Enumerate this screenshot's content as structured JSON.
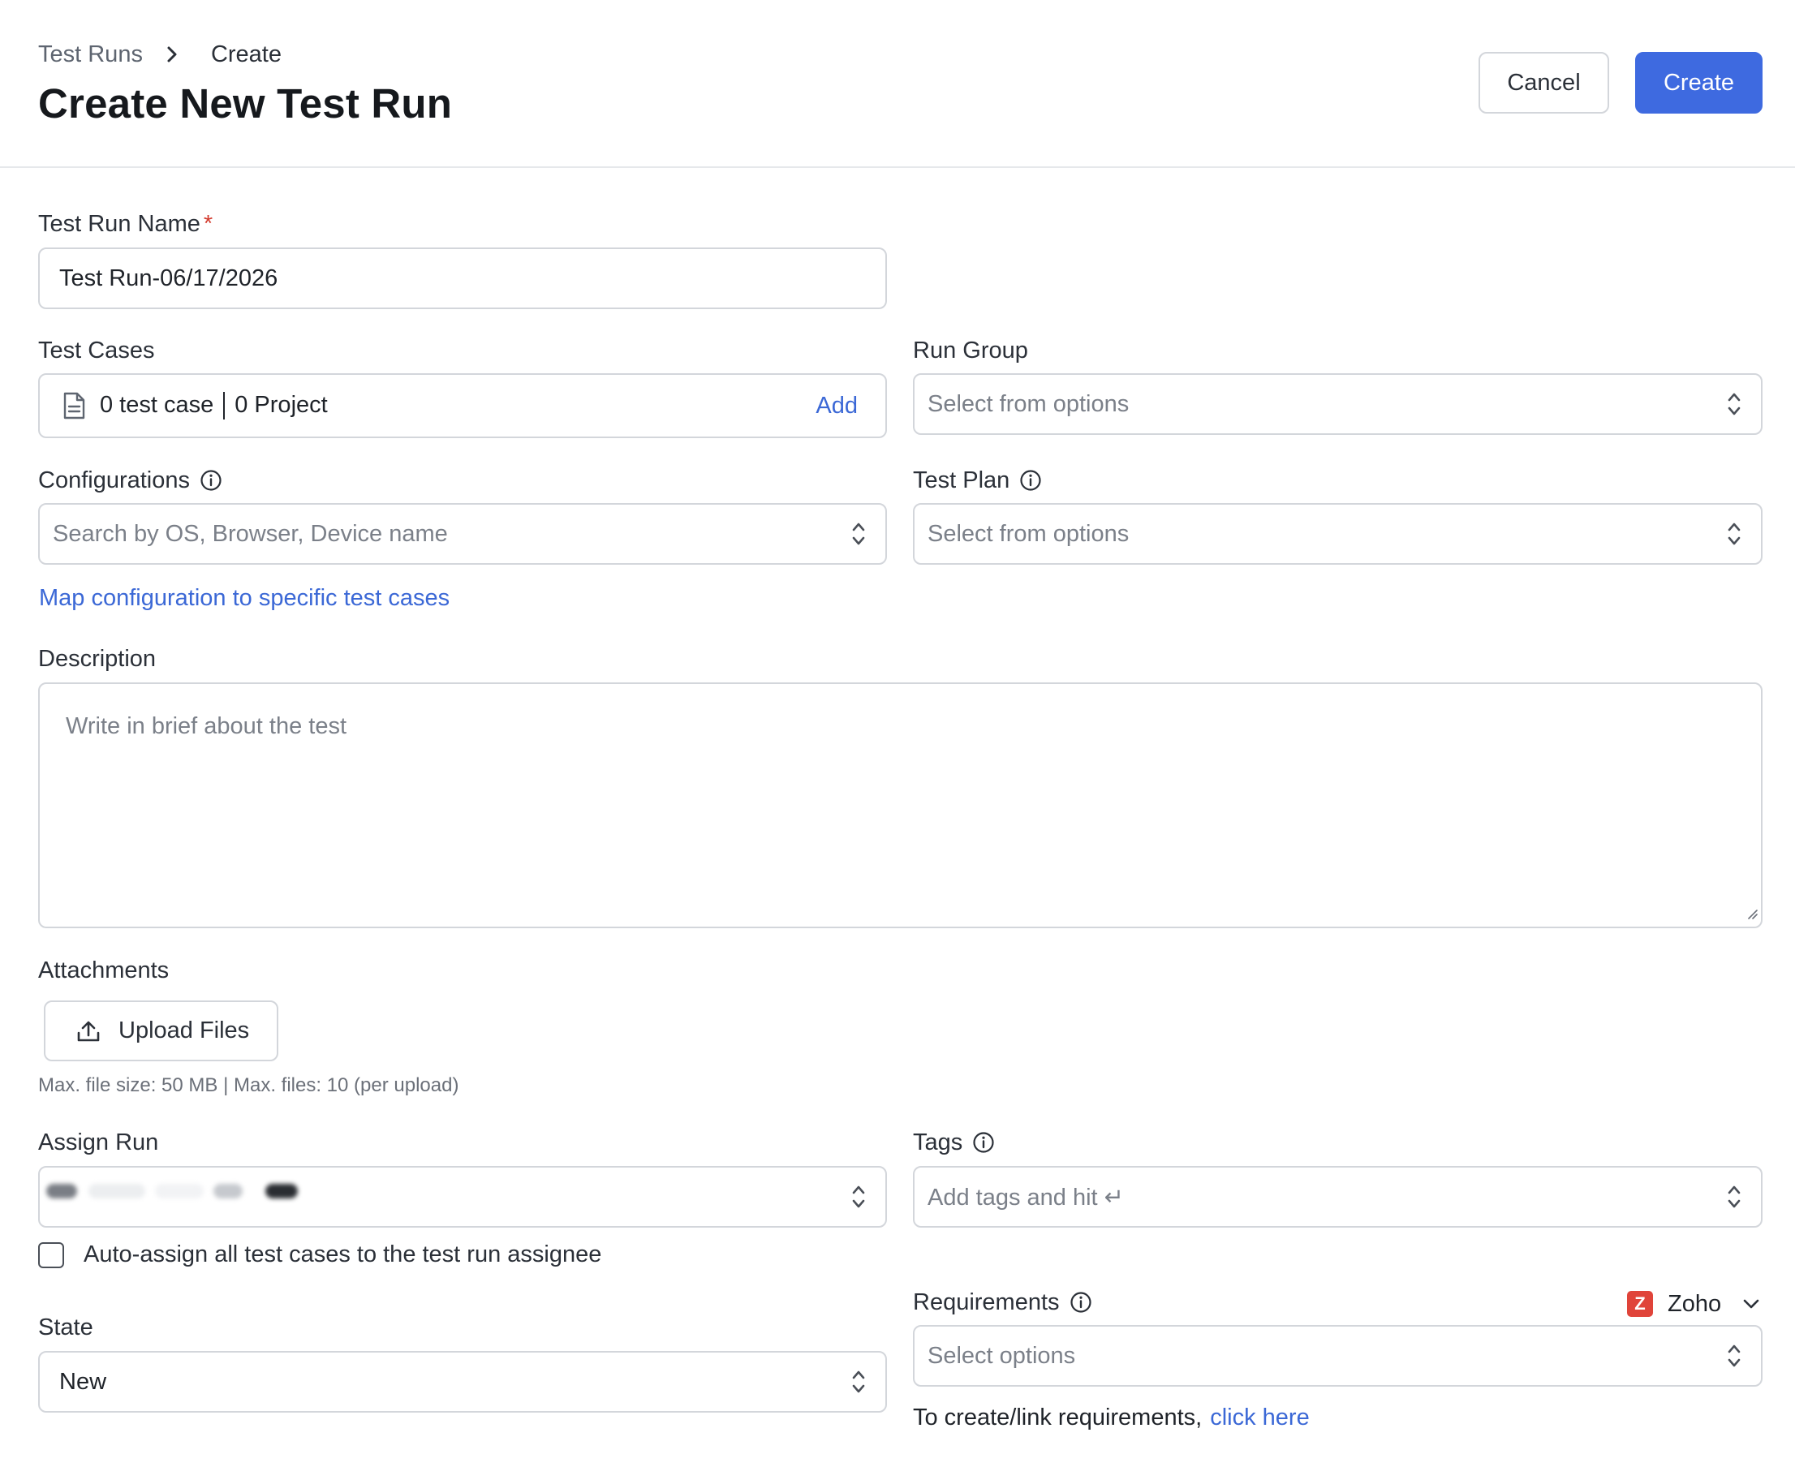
{
  "breadcrumb": {
    "parent": "Test Runs",
    "current": "Create"
  },
  "header": {
    "title": "Create New Test Run",
    "cancel_label": "Cancel",
    "create_label": "Create"
  },
  "form": {
    "test_run_name": {
      "label": "Test Run Name",
      "required_mark": "*",
      "value": "Test Run-06/17/2026"
    },
    "test_cases": {
      "label": "Test Cases",
      "count_text": "0 test case",
      "project_text": "0 Project",
      "add_label": "Add"
    },
    "run_group": {
      "label": "Run Group",
      "placeholder": "Select from options"
    },
    "configurations": {
      "label": "Configurations",
      "placeholder": "Search by OS, Browser, Device name",
      "map_link": "Map configuration to specific test cases"
    },
    "test_plan": {
      "label": "Test Plan",
      "placeholder": "Select from options"
    },
    "description": {
      "label": "Description",
      "placeholder": "Write in brief about the test"
    },
    "attachments": {
      "label": "Attachments",
      "upload_label": "Upload Files",
      "hint": "Max. file size: 50 MB | Max. files: 10 (per upload)"
    },
    "assign_run": {
      "label": "Assign Run",
      "auto_assign_label": "Auto-assign all test cases to the test run assignee",
      "auto_assign_checked": false
    },
    "tags": {
      "label": "Tags",
      "placeholder": "Add tags and hit ↵"
    },
    "state": {
      "label": "State",
      "value": "New"
    },
    "requirements": {
      "label": "Requirements",
      "provider": "Zoho",
      "provider_logo_letter": "Z",
      "placeholder": "Select options",
      "note": "To create/link requirements,",
      "note_link": "click here"
    }
  },
  "colors": {
    "primary": "#3e6ae0",
    "link": "#3b68d6",
    "required": "#d33c2f",
    "zoho": "#e0443a",
    "border": "#d3d6db"
  }
}
